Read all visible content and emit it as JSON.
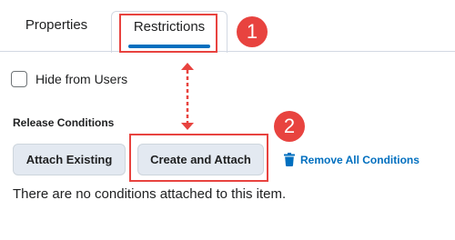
{
  "tabs": [
    {
      "label": "Properties",
      "active": false
    },
    {
      "label": "Restrictions",
      "active": true
    }
  ],
  "callouts": {
    "one": "1",
    "two": "2"
  },
  "visibility": {
    "hide_label": "Hide from Users",
    "checked": false
  },
  "release": {
    "section_label": "Release Conditions",
    "attach_existing_label": "Attach Existing",
    "create_attach_label": "Create and Attach",
    "remove_all_label": "Remove All Conditions",
    "empty_message": "There are no conditions attached to this item."
  },
  "colors": {
    "accent": "#006fbf",
    "callout": "#e8433f",
    "button_bg": "#e3e9f1"
  }
}
